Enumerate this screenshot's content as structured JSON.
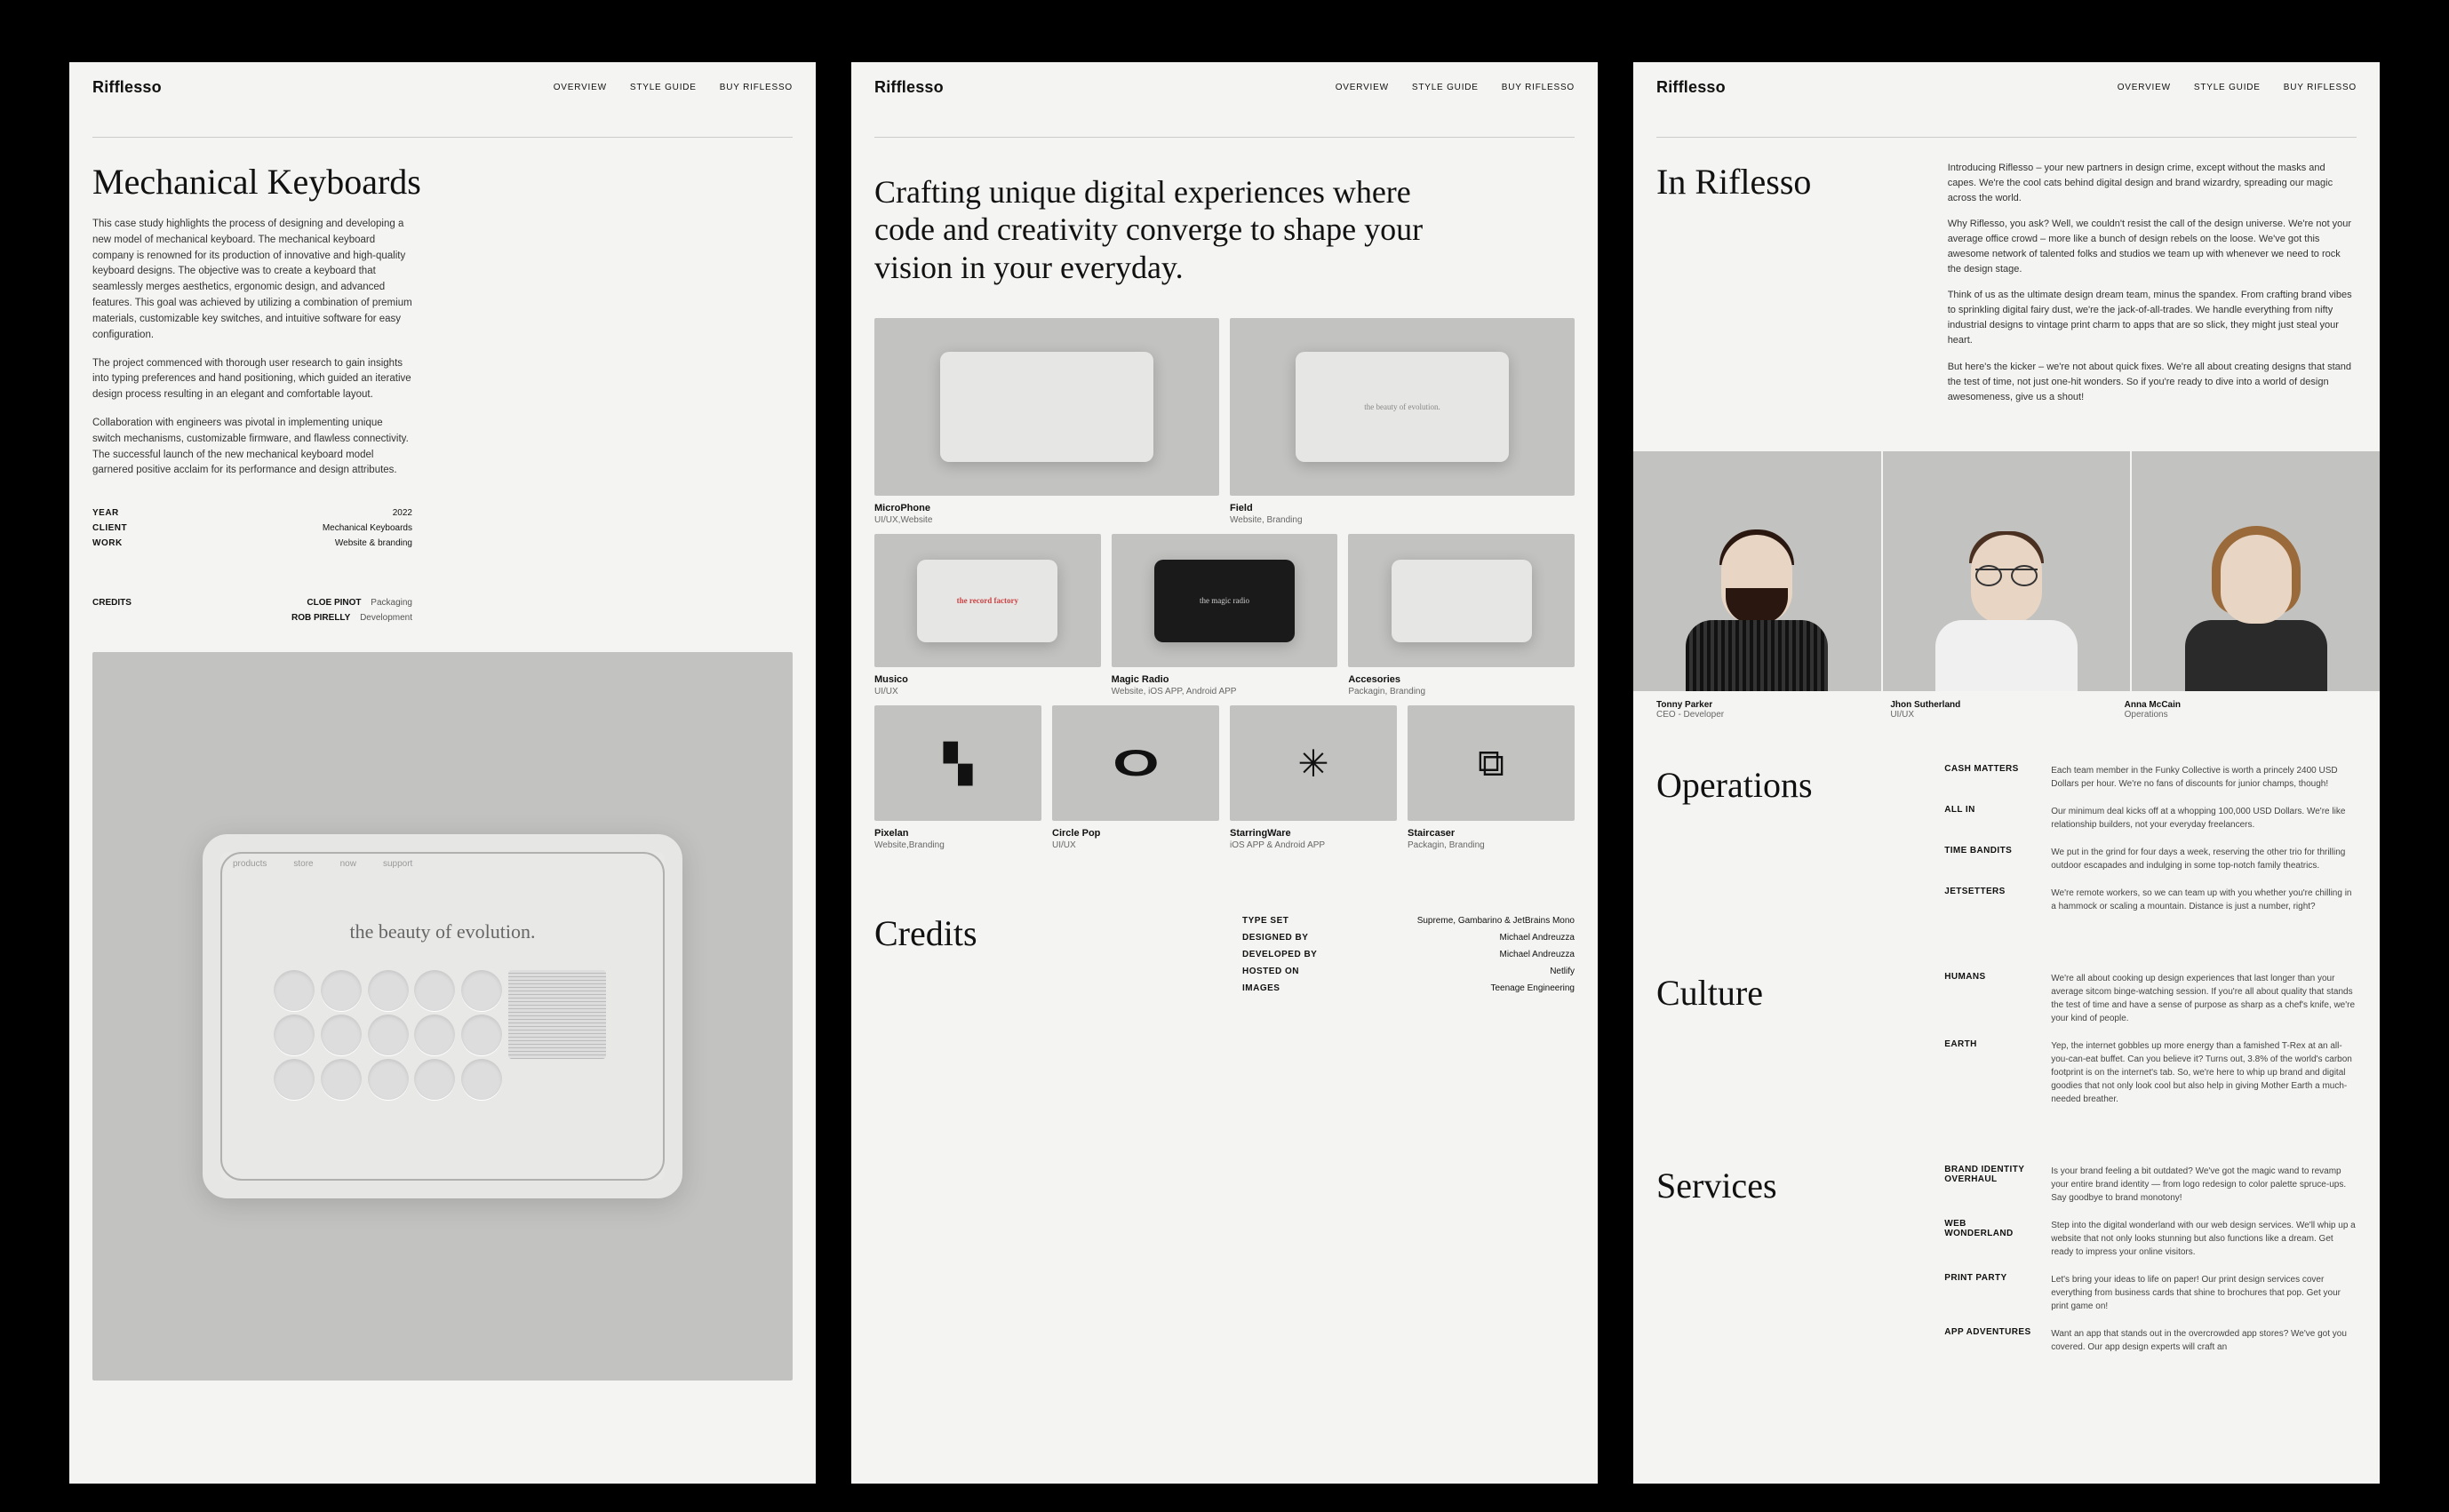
{
  "brand": "Rifflesso",
  "nav": [
    "OVERVIEW",
    "STYLE GUIDE",
    "BUY RIFLESSO"
  ],
  "pane1": {
    "title": "Mechanical Keyboards",
    "p1": "This case study highlights the process of designing and developing a new model of mechanical keyboard. The mechanical keyboard company is renowned for its production of innovative and high-quality keyboard designs. The objective was to create a keyboard that seamlessly merges aesthetics, ergonomic design, and advanced features. This goal was achieved by utilizing a combination of premium materials, customizable key switches, and intuitive software for easy configuration.",
    "p2": "The project commenced with thorough user research to gain insights into typing preferences and hand positioning, which guided an iterative design process resulting in an elegant and comfortable layout.",
    "p3": "Collaboration with engineers was pivotal in implementing unique switch mechanisms, customizable firmware, and flawless connectivity. The successful launch of the new mechanical keyboard model garnered positive acclaim for its performance and design attributes.",
    "meta": [
      {
        "k": "YEAR",
        "v": "2022"
      },
      {
        "k": "CLIENT",
        "v": "Mechanical Keyboards"
      },
      {
        "k": "WORK",
        "v": "Website & branding"
      }
    ],
    "credits_label": "CREDITS",
    "credits": [
      {
        "name": "CLOE PINOT",
        "role": "Packaging"
      },
      {
        "name": "ROB PIRELLY",
        "role": "Development"
      }
    ],
    "tablet_text": "the beauty of evolution."
  },
  "pane2": {
    "headline": "Crafting unique digital experiences where code and creativity converge to shape your vision in your everyday.",
    "row1": [
      {
        "title": "MicroPhone",
        "sub": "UI/UX,Website",
        "inner": ""
      },
      {
        "title": "Field",
        "sub": "Website, Branding",
        "inner": "the beauty of evolution."
      }
    ],
    "row2": [
      {
        "title": "Musico",
        "sub": "UI/UX",
        "inner": "the record factory"
      },
      {
        "title": "Magic Radio",
        "sub": "Website, iOS APP, Android APP",
        "inner": "the magic radio",
        "dark": true
      },
      {
        "title": "Accesories",
        "sub": "Packagin, Branding",
        "inner": ""
      }
    ],
    "row3": [
      {
        "title": "Pixelan",
        "sub": "Website,Branding",
        "icon": "▚"
      },
      {
        "title": "Circle Pop",
        "sub": "UI/UX",
        "icon": "O"
      },
      {
        "title": "StarringWare",
        "sub": "iOS APP & Android APP",
        "icon": "✳"
      },
      {
        "title": "Staircaser",
        "sub": "Packagin, Branding",
        "icon": "⧉"
      }
    ],
    "credits_title": "Credits",
    "credits": [
      {
        "k": "TYPE SET",
        "v": "Supreme, Gambarino & JetBrains Mono"
      },
      {
        "k": "DESIGNED BY",
        "v": "Michael Andreuzza"
      },
      {
        "k": "DEVELOPED BY",
        "v": "Michael Andreuzza"
      },
      {
        "k": "HOSTED ON",
        "v": "Netlify"
      },
      {
        "k": "IMAGES",
        "v": "Teenage Engineering"
      }
    ]
  },
  "pane3": {
    "title": "In Riflesso",
    "intro": [
      "Introducing Riflesso – your new partners in design crime, except without the masks and capes. We're the cool cats behind digital design and brand wizardry, spreading our magic across the world.",
      "Why Riflesso, you ask? Well, we couldn't resist the call of the design universe. We're not your average office crowd – more like a bunch of design rebels on the loose. We've got this awesome network of talented folks and studios we team up with whenever we need to rock the design stage.",
      "Think of us as the ultimate design dream team, minus the spandex. From crafting brand vibes to sprinkling digital fairy dust, we're the jack-of-all-trades. We handle everything from nifty industrial designs to vintage print charm to apps that are so slick, they might just steal your heart.",
      "But here's the kicker – we're not about quick fixes. We're all about creating designs that stand the test of time, not just one-hit wonders. So if you're ready to dive into a world of design awesomeness, give us a shout!"
    ],
    "team": [
      {
        "name": "Tonny Parker",
        "role": "CEO - Developer"
      },
      {
        "name": "Jhon Sutherland",
        "role": "UI/UX"
      },
      {
        "name": "Anna McCain",
        "role": "Operations"
      }
    ],
    "operations": {
      "title": "Operations",
      "rows": [
        {
          "k": "CASH MATTERS",
          "v": "Each team member in the Funky Collective is worth a princely 2400 USD Dollars per hour. We're no fans of discounts for junior champs, though!"
        },
        {
          "k": "ALL IN",
          "v": "Our minimum deal kicks off at a whopping 100,000 USD Dollars. We're like relationship builders, not your everyday freelancers."
        },
        {
          "k": "TIME BANDITS",
          "v": "We put in the grind for four days a week, reserving the other trio for thrilling outdoor escapades and indulging in some top-notch family theatrics."
        },
        {
          "k": "JETSETTERS",
          "v": "We're remote workers, so we can team up with you whether you're chilling in a hammock or scaling a mountain. Distance is just a number, right?"
        }
      ]
    },
    "culture": {
      "title": "Culture",
      "rows": [
        {
          "k": "HUMANS",
          "v": "We're all about cooking up design experiences that last longer than your average sitcom binge-watching session. If you're all about quality that stands the test of time and have a sense of purpose as sharp as a chef's knife, we're your kind of people."
        },
        {
          "k": "EARTH",
          "v": "Yep, the internet gobbles up more energy than a famished T-Rex at an all-you-can-eat buffet. Can you believe it? Turns out, 3.8% of the world's carbon footprint is on the internet's tab. So, we're here to whip up brand and digital goodies that not only look cool but also help in giving Mother Earth a much-needed breather."
        }
      ]
    },
    "services": {
      "title": "Services",
      "rows": [
        {
          "k": "BRAND IDENTITY OVERHAUL",
          "v": "Is your brand feeling a bit outdated? We've got the magic wand to revamp your entire brand identity — from logo redesign to color palette spruce-ups. Say goodbye to brand monotony!"
        },
        {
          "k": "WEB WONDERLAND",
          "v": "Step into the digital wonderland with our web design services. We'll whip up a website that not only looks stunning but also functions like a dream. Get ready to impress your online visitors."
        },
        {
          "k": "PRINT PARTY",
          "v": "Let's bring your ideas to life on paper! Our print design services cover everything from business cards that shine to brochures that pop. Get your print game on!"
        },
        {
          "k": "APP ADVENTURES",
          "v": "Want an app that stands out in the overcrowded app stores? We've got you covered. Our app design experts will craft an"
        }
      ]
    }
  }
}
